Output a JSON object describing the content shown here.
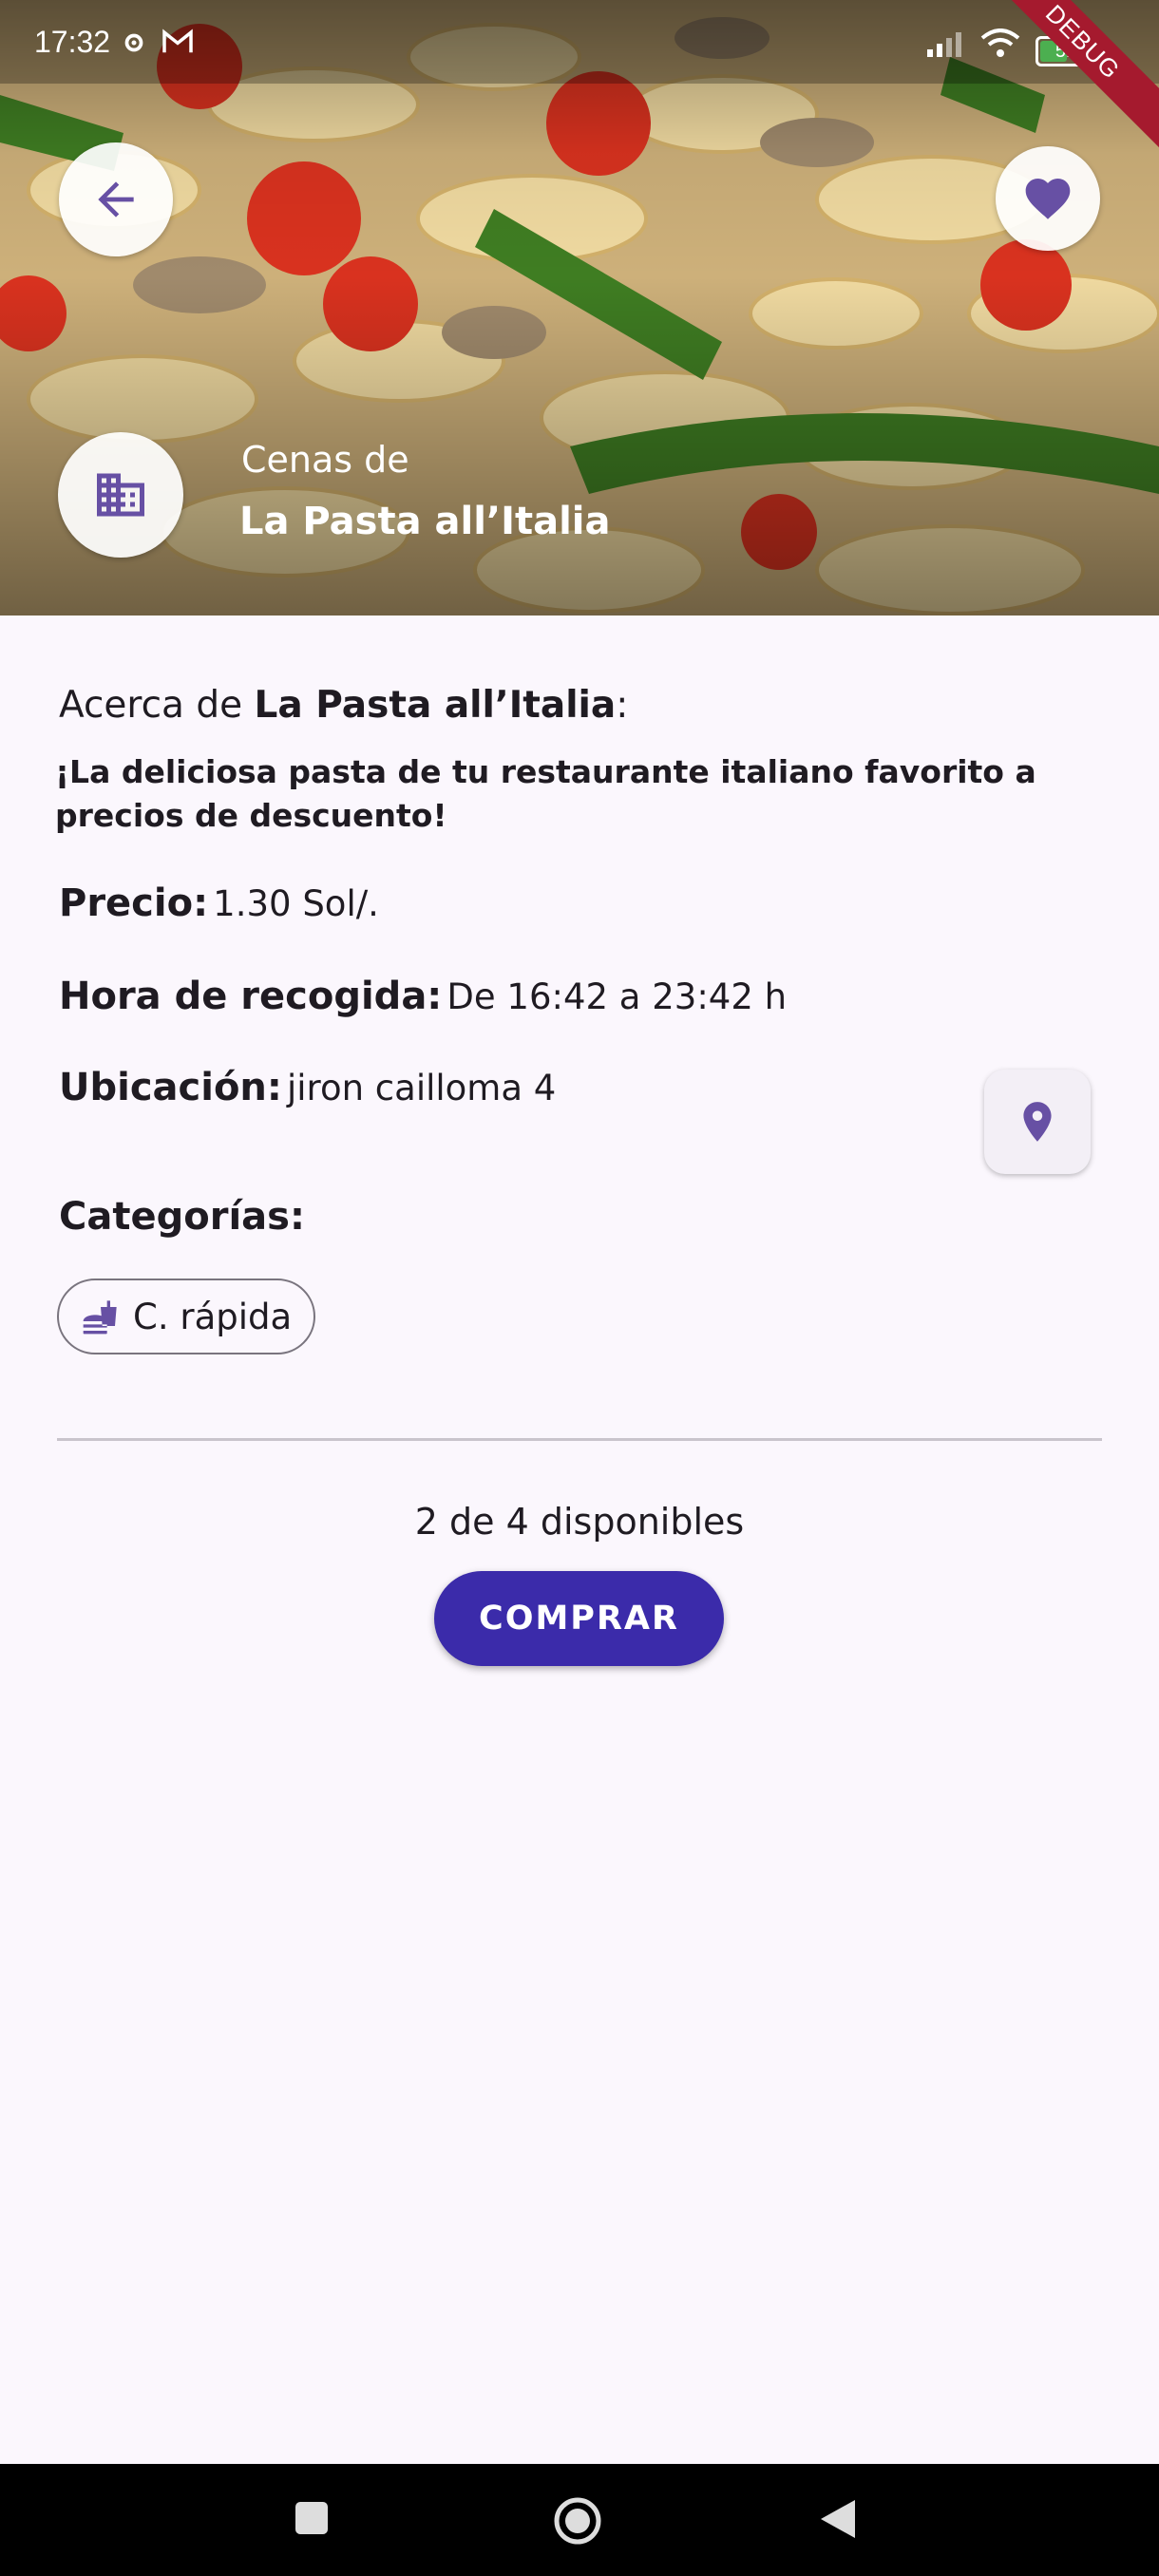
{
  "status_bar": {
    "time": "17:32",
    "battery": "51",
    "battery_level": 0.51,
    "debug_label": "DEBUG"
  },
  "hero": {
    "subtitle": "Cenas de",
    "title": "La Pasta all’Italia",
    "back_icon": "arrow-back-icon",
    "favorite_icon": "heart-icon",
    "store_icon": "building-icon"
  },
  "details": {
    "about_prefix": "Acerca de ",
    "about_name": "La Pasta all’Italia",
    "about_suffix": ":",
    "description": "¡La deliciosa pasta de tu restaurante italiano favorito a precios de descuento!",
    "price_label": "Precio:",
    "price_value": "1.30 Sol/.",
    "pickup_label": "Hora de recogida:",
    "pickup_value": "De 16:42 a 23:42 h",
    "location_label": "Ubicación:",
    "location_value": "jiron cailloma 4",
    "categories_label": "Categorías:",
    "categories": [
      {
        "label": "C. rápida",
        "icon": "fastfood-icon"
      }
    ]
  },
  "purchase": {
    "availability": "2 de 4 disponibles",
    "buy_label": "COMPRAR"
  },
  "colors": {
    "accent": "#6750A4",
    "buy_button": "#3B2BAA",
    "background": "#FBF7FD"
  }
}
